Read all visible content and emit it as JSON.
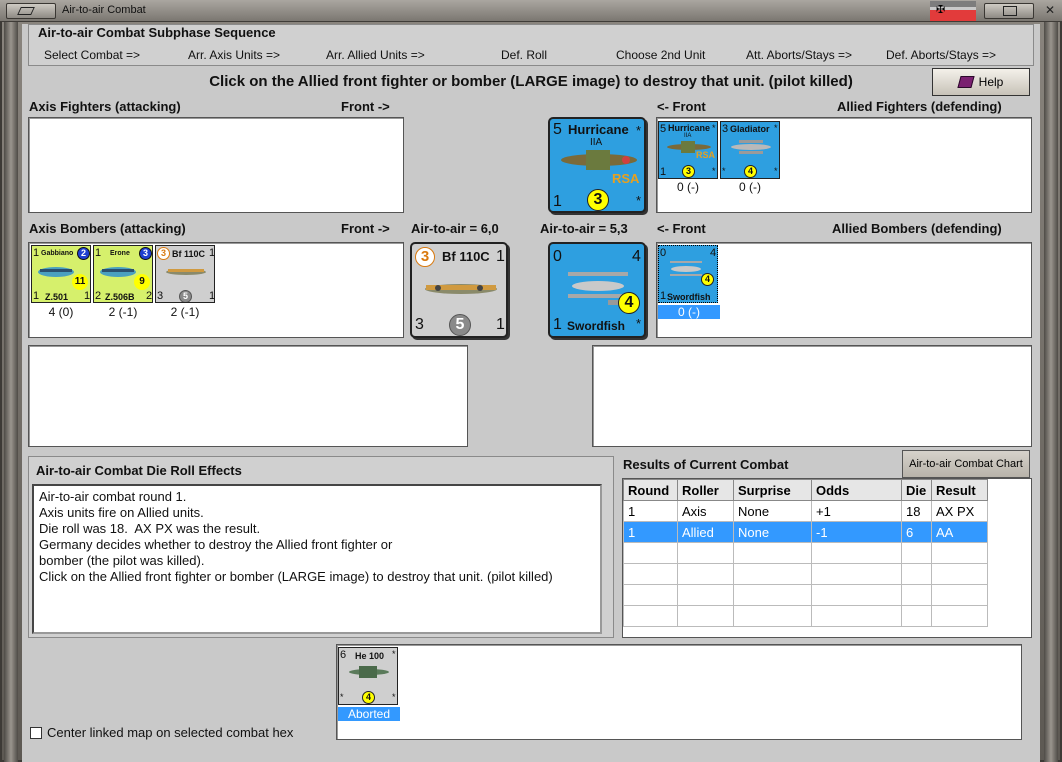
{
  "window": {
    "title": "Air-to-air Combat"
  },
  "sequence": {
    "title": "Air-to-air Combat Subphase Sequence",
    "steps": [
      "Select Combat =>",
      "Arr. Axis Units =>",
      "Arr. Allied Units =>",
      "Def. Roll",
      "Choose 2nd Unit",
      "Att. Aborts/Stays =>",
      "Def. Aborts/Stays =>"
    ]
  },
  "instruction": "Click on the Allied front fighter or bomber (LARGE image) to destroy that unit. (pilot killed)",
  "help_label": "Help",
  "labels": {
    "axis_fighters": "Axis Fighters (attacking)",
    "axis_fighters_front": "Front ->",
    "allied_fighters_front": "<- Front",
    "allied_fighters": "Allied Fighters (defending)",
    "axis_bombers": "Axis Bombers (attacking)",
    "axis_bombers_front": "Front ->",
    "axis_air_to_air": "Air-to-air = 6,0",
    "allied_air_to_air": "Air-to-air = 5,3",
    "allied_bombers_front": "<- Front",
    "allied_bombers": "Allied Bombers (defending)"
  },
  "big_allied_fighter": {
    "name": "Hurricane",
    "variant": "IIA",
    "tl": "5",
    "tr": "*",
    "bl": "1",
    "circle": "3",
    "br": "*",
    "tag": "RSA"
  },
  "allied_fighters": [
    {
      "name": "Hurricane",
      "variant": "IIA",
      "tl": "5",
      "tr": "*",
      "bl": "1",
      "circle": "3",
      "br": "*",
      "tag": "RSA",
      "status": "0 (-)"
    },
    {
      "name": "Gladiator",
      "tl": "3",
      "tr": "*",
      "bl": "*",
      "circle": "4",
      "br": "*",
      "status": "0 (-)"
    }
  ],
  "axis_bombers": [
    {
      "name": "Gabbiano",
      "tl": "1",
      "badge": "2",
      "model": "Z.501",
      "bl": "1",
      "br": "1",
      "circle": "11",
      "status": "4 (0)"
    },
    {
      "name": "Erone",
      "tl": "1",
      "badge": "3",
      "model": "Z.506B",
      "bl": "2",
      "br": "2",
      "circle": "9",
      "status": "2 (-1)"
    },
    {
      "name": "Bf 110C",
      "tl": "3",
      "tr": "1",
      "bl": "3",
      "circle": "5",
      "br": "1",
      "status": "2 (-1)"
    }
  ],
  "big_axis_bomber": {
    "name": "Bf 110C",
    "tl": "3",
    "tr": "1",
    "bl": "3",
    "circle": "5",
    "br": "1"
  },
  "big_allied_bomber": {
    "name": "Swordfish",
    "tl": "0",
    "tr": "4",
    "bl": "1",
    "circle": "4",
    "br": "*"
  },
  "allied_bombers": [
    {
      "name": "Swordfish",
      "tl": "0",
      "tr": "4",
      "bl": "1",
      "circle": "4",
      "status": "0 (-)"
    }
  ],
  "effects": {
    "title": "Air-to-air Combat Die Roll Effects",
    "lines": [
      "Air-to-air combat round 1.",
      "Axis units fire on Allied units.",
      "Die roll was 18.  AX PX was the result.",
      "Germany decides whether to destroy the Allied front fighter or",
      "bomber (the pilot was killed).",
      "Click on the Allied front fighter or bomber (LARGE image) to destroy that unit. (pilot killed)"
    ]
  },
  "results": {
    "title": "Results of Current Combat",
    "chart_button": "Air-to-air Combat Chart",
    "columns": [
      "Round",
      "Roller",
      "Surprise",
      "Odds",
      "Die",
      "Result"
    ],
    "rows": [
      [
        "1",
        "Axis",
        "None",
        "+1",
        "18",
        "AX PX"
      ],
      [
        "1",
        "Allied",
        "None",
        "-1",
        "6",
        "AA"
      ]
    ]
  },
  "aborted_unit": {
    "name": "He 100",
    "tl": "6",
    "tr": "*",
    "bl": "*",
    "circle": "4",
    "br": "*",
    "status": "Aborted"
  },
  "center_map_label": "Center linked map on selected combat hex",
  "colors": {
    "counter_blue": "#2e9fe0",
    "italian_green": "#d6f06c",
    "selection": "#3399ff"
  }
}
